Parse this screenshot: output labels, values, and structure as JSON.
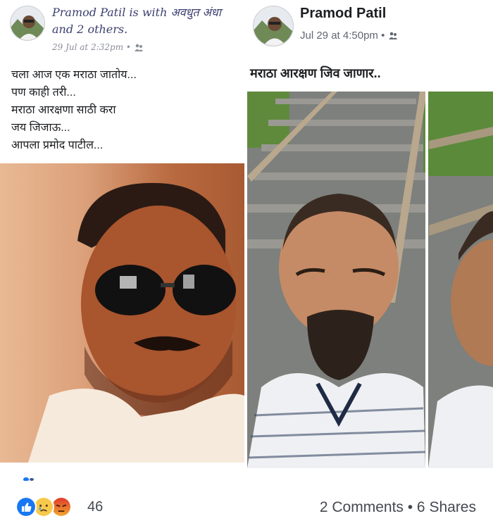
{
  "left_post": {
    "author": "Pramod Patil",
    "with_text": "is with अवधुत अंधा",
    "others_text": "and 2 others.",
    "timestamp": "29 Jul at 2:32pm",
    "lines": [
      "चला आज एक मराठा जातोय...",
      "पण काही तरी...",
      "मराठा आरक्षणा साठी करा",
      "जय जिजाऊ...",
      "आपला प्रमोद पाटील..."
    ]
  },
  "right_post": {
    "author": "Pramod Patil",
    "timestamp": "Jul 29 at 4:50pm",
    "text": "मराठा आरक्षण जिव जाणार.."
  },
  "footer": {
    "reaction_count": "46",
    "comments_shares": "2 Comments • 6 Shares"
  },
  "colors": {
    "like_blue": "#1877f2",
    "sad_yellow": "#f7c94b",
    "angry_red": "#e9710f"
  }
}
